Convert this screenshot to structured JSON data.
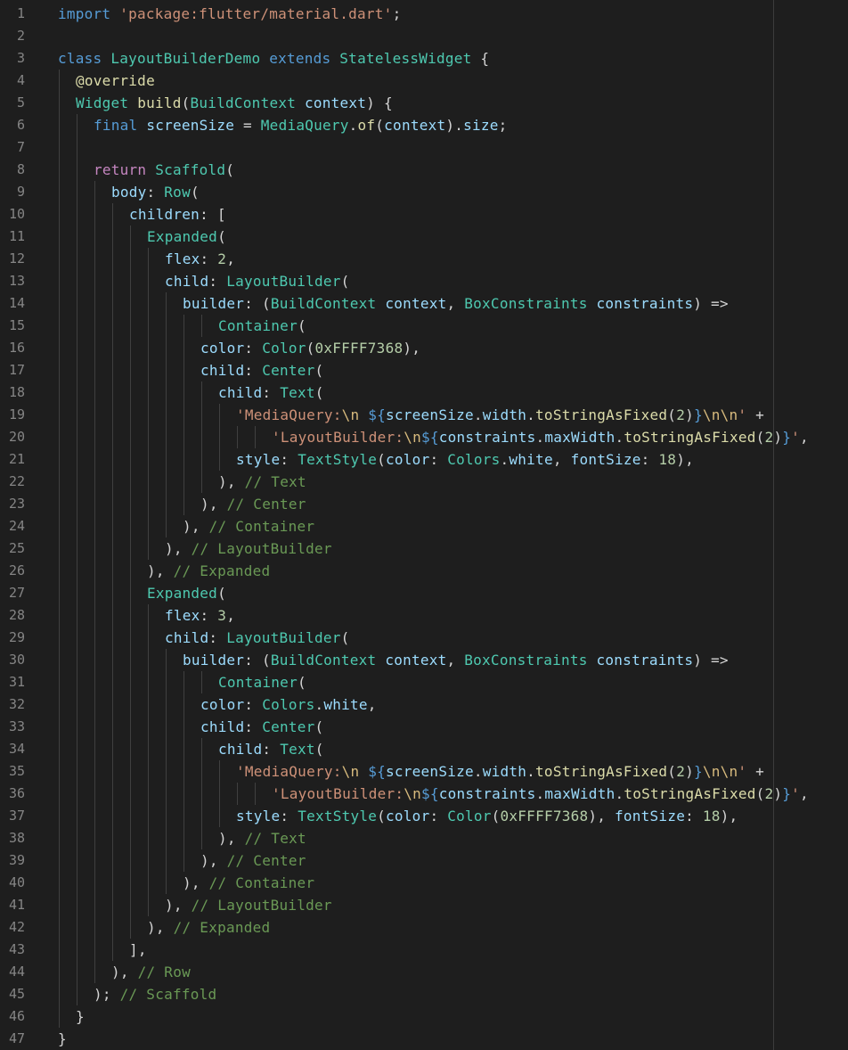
{
  "editor": {
    "language": "dart",
    "colors": {
      "background": "#1e1e1e",
      "line_number": "#858585",
      "keyword": "#569cd6",
      "control": "#c586c0",
      "type": "#4ec9b0",
      "function": "#dcdcaa",
      "variable": "#9cdcfe",
      "string": "#ce9178",
      "number": "#b5cea8",
      "comment": "#6a9955",
      "punctuation": "#d4d4d4",
      "escape": "#d7ba7d"
    },
    "lines": [
      {
        "n": "1",
        "indent": 0,
        "tokens": [
          [
            "import",
            "kw"
          ],
          [
            " ",
            "pn"
          ],
          [
            "'package:flutter/material.dart'",
            "str"
          ],
          [
            ";",
            "pn"
          ]
        ]
      },
      {
        "n": "2",
        "indent": 0,
        "tokens": []
      },
      {
        "n": "3",
        "indent": 0,
        "tokens": [
          [
            "class",
            "kw"
          ],
          [
            " ",
            "pn"
          ],
          [
            "LayoutBuilderDemo",
            "ty"
          ],
          [
            " ",
            "pn"
          ],
          [
            "extends",
            "kw"
          ],
          [
            " ",
            "pn"
          ],
          [
            "StatelessWidget",
            "ty"
          ],
          [
            " {",
            "pn"
          ]
        ]
      },
      {
        "n": "4",
        "indent": 1,
        "tokens": [
          [
            "@override",
            "fn"
          ]
        ]
      },
      {
        "n": "5",
        "indent": 1,
        "tokens": [
          [
            "Widget",
            "ty"
          ],
          [
            " ",
            "pn"
          ],
          [
            "build",
            "fn"
          ],
          [
            "(",
            "pn"
          ],
          [
            "BuildContext",
            "ty"
          ],
          [
            " ",
            "pn"
          ],
          [
            "context",
            "var"
          ],
          [
            ") {",
            "pn"
          ]
        ]
      },
      {
        "n": "6",
        "indent": 2,
        "tokens": [
          [
            "final",
            "kw"
          ],
          [
            " ",
            "pn"
          ],
          [
            "screenSize",
            "var"
          ],
          [
            " = ",
            "op"
          ],
          [
            "MediaQuery",
            "ty"
          ],
          [
            ".",
            "pn"
          ],
          [
            "of",
            "fn"
          ],
          [
            "(",
            "pn"
          ],
          [
            "context",
            "var"
          ],
          [
            ").",
            "pn"
          ],
          [
            "size",
            "var"
          ],
          [
            ";",
            "pn"
          ]
        ]
      },
      {
        "n": "7",
        "indent": 2,
        "tokens": []
      },
      {
        "n": "8",
        "indent": 2,
        "tokens": [
          [
            "return",
            "ctl"
          ],
          [
            " ",
            "pn"
          ],
          [
            "Scaffold",
            "ty"
          ],
          [
            "(",
            "pn"
          ]
        ]
      },
      {
        "n": "9",
        "indent": 3,
        "tokens": [
          [
            "body",
            "var"
          ],
          [
            ": ",
            "pn"
          ],
          [
            "Row",
            "ty"
          ],
          [
            "(",
            "pn"
          ]
        ]
      },
      {
        "n": "10",
        "indent": 4,
        "tokens": [
          [
            "children",
            "var"
          ],
          [
            ": [",
            "pn"
          ]
        ]
      },
      {
        "n": "11",
        "indent": 5,
        "tokens": [
          [
            "Expanded",
            "ty"
          ],
          [
            "(",
            "pn"
          ]
        ]
      },
      {
        "n": "12",
        "indent": 6,
        "tokens": [
          [
            "flex",
            "var"
          ],
          [
            ": ",
            "pn"
          ],
          [
            "2",
            "num"
          ],
          [
            ",",
            "pn"
          ]
        ]
      },
      {
        "n": "13",
        "indent": 6,
        "tokens": [
          [
            "child",
            "var"
          ],
          [
            ": ",
            "pn"
          ],
          [
            "LayoutBuilder",
            "ty"
          ],
          [
            "(",
            "pn"
          ]
        ]
      },
      {
        "n": "14",
        "indent": 7,
        "tokens": [
          [
            "builder",
            "var"
          ],
          [
            ": (",
            "pn"
          ],
          [
            "BuildContext",
            "ty"
          ],
          [
            " ",
            "pn"
          ],
          [
            "context",
            "var"
          ],
          [
            ", ",
            "pn"
          ],
          [
            "BoxConstraints",
            "ty"
          ],
          [
            " ",
            "pn"
          ],
          [
            "constraints",
            "var"
          ],
          [
            ") =>",
            "pn"
          ]
        ]
      },
      {
        "n": "15",
        "indent": 9,
        "tokens": [
          [
            "Container",
            "ty"
          ],
          [
            "(",
            "pn"
          ]
        ]
      },
      {
        "n": "16",
        "indent": 8,
        "tokens": [
          [
            "color",
            "var"
          ],
          [
            ": ",
            "pn"
          ],
          [
            "Color",
            "ty"
          ],
          [
            "(",
            "pn"
          ],
          [
            "0xFFFF7368",
            "num"
          ],
          [
            "),",
            "pn"
          ]
        ]
      },
      {
        "n": "17",
        "indent": 8,
        "tokens": [
          [
            "child",
            "var"
          ],
          [
            ": ",
            "pn"
          ],
          [
            "Center",
            "ty"
          ],
          [
            "(",
            "pn"
          ]
        ]
      },
      {
        "n": "18",
        "indent": 9,
        "tokens": [
          [
            "child",
            "var"
          ],
          [
            ": ",
            "pn"
          ],
          [
            "Text",
            "ty"
          ],
          [
            "(",
            "pn"
          ]
        ]
      },
      {
        "n": "19",
        "indent": 10,
        "tokens": [
          [
            "'MediaQuery:",
            "str"
          ],
          [
            "\\n",
            "esc"
          ],
          [
            " ",
            "str"
          ],
          [
            "${",
            "kw"
          ],
          [
            "screenSize",
            "var"
          ],
          [
            ".",
            "pn"
          ],
          [
            "width",
            "var"
          ],
          [
            ".",
            "pn"
          ],
          [
            "toStringAsFixed",
            "fn"
          ],
          [
            "(",
            "pn"
          ],
          [
            "2",
            "num"
          ],
          [
            ")",
            "pn"
          ],
          [
            "}",
            "kw"
          ],
          [
            "\\n\\n",
            "esc"
          ],
          [
            "'",
            "str"
          ],
          [
            " +",
            "pn"
          ]
        ]
      },
      {
        "n": "20",
        "indent": 12,
        "tokens": [
          [
            "'LayoutBuilder:",
            "str"
          ],
          [
            "\\n",
            "esc"
          ],
          [
            "${",
            "kw"
          ],
          [
            "constraints",
            "var"
          ],
          [
            ".",
            "pn"
          ],
          [
            "maxWidth",
            "var"
          ],
          [
            ".",
            "pn"
          ],
          [
            "toStringAsFixed",
            "fn"
          ],
          [
            "(",
            "pn"
          ],
          [
            "2",
            "num"
          ],
          [
            ")",
            "pn"
          ],
          [
            "}",
            "kw"
          ],
          [
            "'",
            "str"
          ],
          [
            ",",
            "pn"
          ]
        ]
      },
      {
        "n": "21",
        "indent": 10,
        "tokens": [
          [
            "style",
            "var"
          ],
          [
            ": ",
            "pn"
          ],
          [
            "TextStyle",
            "ty"
          ],
          [
            "(",
            "pn"
          ],
          [
            "color",
            "var"
          ],
          [
            ": ",
            "pn"
          ],
          [
            "Colors",
            "ty"
          ],
          [
            ".",
            "pn"
          ],
          [
            "white",
            "var"
          ],
          [
            ", ",
            "pn"
          ],
          [
            "fontSize",
            "var"
          ],
          [
            ": ",
            "pn"
          ],
          [
            "18",
            "num"
          ],
          [
            "),",
            "pn"
          ]
        ]
      },
      {
        "n": "22",
        "indent": 9,
        "tokens": [
          [
            "), ",
            "pn"
          ],
          [
            "// Text",
            "cm"
          ]
        ]
      },
      {
        "n": "23",
        "indent": 8,
        "tokens": [
          [
            "), ",
            "pn"
          ],
          [
            "// Center",
            "cm"
          ]
        ]
      },
      {
        "n": "24",
        "indent": 7,
        "tokens": [
          [
            "), ",
            "pn"
          ],
          [
            "// Container",
            "cm"
          ]
        ]
      },
      {
        "n": "25",
        "indent": 6,
        "tokens": [
          [
            "), ",
            "pn"
          ],
          [
            "// LayoutBuilder",
            "cm"
          ]
        ]
      },
      {
        "n": "26",
        "indent": 5,
        "tokens": [
          [
            "), ",
            "pn"
          ],
          [
            "// Expanded",
            "cm"
          ]
        ]
      },
      {
        "n": "27",
        "indent": 5,
        "tokens": [
          [
            "Expanded",
            "ty"
          ],
          [
            "(",
            "pn"
          ]
        ]
      },
      {
        "n": "28",
        "indent": 6,
        "tokens": [
          [
            "flex",
            "var"
          ],
          [
            ": ",
            "pn"
          ],
          [
            "3",
            "num"
          ],
          [
            ",",
            "pn"
          ]
        ]
      },
      {
        "n": "29",
        "indent": 6,
        "tokens": [
          [
            "child",
            "var"
          ],
          [
            ": ",
            "pn"
          ],
          [
            "LayoutBuilder",
            "ty"
          ],
          [
            "(",
            "pn"
          ]
        ]
      },
      {
        "n": "30",
        "indent": 7,
        "tokens": [
          [
            "builder",
            "var"
          ],
          [
            ": (",
            "pn"
          ],
          [
            "BuildContext",
            "ty"
          ],
          [
            " ",
            "pn"
          ],
          [
            "context",
            "var"
          ],
          [
            ", ",
            "pn"
          ],
          [
            "BoxConstraints",
            "ty"
          ],
          [
            " ",
            "pn"
          ],
          [
            "constraints",
            "var"
          ],
          [
            ") =>",
            "pn"
          ]
        ]
      },
      {
        "n": "31",
        "indent": 9,
        "tokens": [
          [
            "Container",
            "ty"
          ],
          [
            "(",
            "pn"
          ]
        ]
      },
      {
        "n": "32",
        "indent": 8,
        "tokens": [
          [
            "color",
            "var"
          ],
          [
            ": ",
            "pn"
          ],
          [
            "Colors",
            "ty"
          ],
          [
            ".",
            "pn"
          ],
          [
            "white",
            "var"
          ],
          [
            ",",
            "pn"
          ]
        ]
      },
      {
        "n": "33",
        "indent": 8,
        "tokens": [
          [
            "child",
            "var"
          ],
          [
            ": ",
            "pn"
          ],
          [
            "Center",
            "ty"
          ],
          [
            "(",
            "pn"
          ]
        ]
      },
      {
        "n": "34",
        "indent": 9,
        "tokens": [
          [
            "child",
            "var"
          ],
          [
            ": ",
            "pn"
          ],
          [
            "Text",
            "ty"
          ],
          [
            "(",
            "pn"
          ]
        ]
      },
      {
        "n": "35",
        "indent": 10,
        "tokens": [
          [
            "'MediaQuery:",
            "str"
          ],
          [
            "\\n",
            "esc"
          ],
          [
            " ",
            "str"
          ],
          [
            "${",
            "kw"
          ],
          [
            "screenSize",
            "var"
          ],
          [
            ".",
            "pn"
          ],
          [
            "width",
            "var"
          ],
          [
            ".",
            "pn"
          ],
          [
            "toStringAsFixed",
            "fn"
          ],
          [
            "(",
            "pn"
          ],
          [
            "2",
            "num"
          ],
          [
            ")",
            "pn"
          ],
          [
            "}",
            "kw"
          ],
          [
            "\\n\\n",
            "esc"
          ],
          [
            "'",
            "str"
          ],
          [
            " +",
            "pn"
          ]
        ]
      },
      {
        "n": "36",
        "indent": 12,
        "tokens": [
          [
            "'LayoutBuilder:",
            "str"
          ],
          [
            "\\n",
            "esc"
          ],
          [
            "${",
            "kw"
          ],
          [
            "constraints",
            "var"
          ],
          [
            ".",
            "pn"
          ],
          [
            "maxWidth",
            "var"
          ],
          [
            ".",
            "pn"
          ],
          [
            "toStringAsFixed",
            "fn"
          ],
          [
            "(",
            "pn"
          ],
          [
            "2",
            "num"
          ],
          [
            ")",
            "pn"
          ],
          [
            "}",
            "kw"
          ],
          [
            "'",
            "str"
          ],
          [
            ",",
            "pn"
          ]
        ]
      },
      {
        "n": "37",
        "indent": 10,
        "tokens": [
          [
            "style",
            "var"
          ],
          [
            ": ",
            "pn"
          ],
          [
            "TextStyle",
            "ty"
          ],
          [
            "(",
            "pn"
          ],
          [
            "color",
            "var"
          ],
          [
            ": ",
            "pn"
          ],
          [
            "Color",
            "ty"
          ],
          [
            "(",
            "pn"
          ],
          [
            "0xFFFF7368",
            "num"
          ],
          [
            "), ",
            "pn"
          ],
          [
            "fontSize",
            "var"
          ],
          [
            ": ",
            "pn"
          ],
          [
            "18",
            "num"
          ],
          [
            "),",
            "pn"
          ]
        ]
      },
      {
        "n": "38",
        "indent": 9,
        "tokens": [
          [
            "), ",
            "pn"
          ],
          [
            "// Text",
            "cm"
          ]
        ]
      },
      {
        "n": "39",
        "indent": 8,
        "tokens": [
          [
            "), ",
            "pn"
          ],
          [
            "// Center",
            "cm"
          ]
        ]
      },
      {
        "n": "40",
        "indent": 7,
        "tokens": [
          [
            "), ",
            "pn"
          ],
          [
            "// Container",
            "cm"
          ]
        ]
      },
      {
        "n": "41",
        "indent": 6,
        "tokens": [
          [
            "), ",
            "pn"
          ],
          [
            "// LayoutBuilder",
            "cm"
          ]
        ]
      },
      {
        "n": "42",
        "indent": 5,
        "tokens": [
          [
            "), ",
            "pn"
          ],
          [
            "// Expanded",
            "cm"
          ]
        ]
      },
      {
        "n": "43",
        "indent": 4,
        "tokens": [
          [
            "],",
            "pn"
          ]
        ]
      },
      {
        "n": "44",
        "indent": 3,
        "tokens": [
          [
            "), ",
            "pn"
          ],
          [
            "// Row",
            "cm"
          ]
        ]
      },
      {
        "n": "45",
        "indent": 2,
        "tokens": [
          [
            "); ",
            "pn"
          ],
          [
            "// Scaffold",
            "cm"
          ]
        ]
      },
      {
        "n": "46",
        "indent": 1,
        "tokens": [
          [
            "}",
            "pn"
          ]
        ]
      },
      {
        "n": "47",
        "indent": 0,
        "tokens": [
          [
            "}",
            "pn"
          ]
        ]
      }
    ]
  }
}
